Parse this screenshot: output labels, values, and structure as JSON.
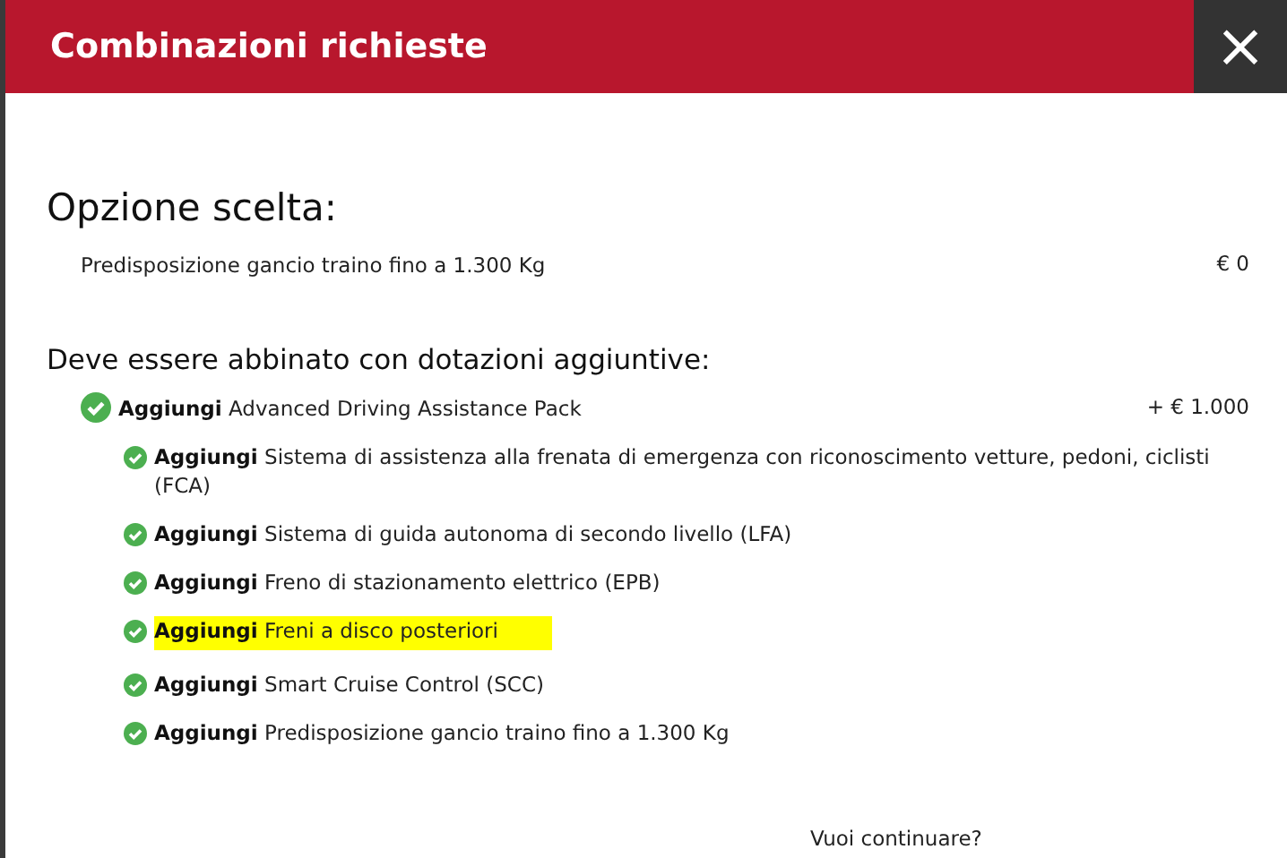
{
  "dialog": {
    "title": "Combinazioni richieste",
    "close_icon": "×"
  },
  "chosen_option": {
    "heading": "Opzione scelta:",
    "name": "Predisposizione gancio traino fino a 1.300 Kg",
    "price": "€ 0"
  },
  "required": {
    "heading": "Deve essere abbinato con dotazioni aggiuntive:",
    "items": [
      {
        "text": "**Aggiungi** Advanced Driving Assistance Pack",
        "price": "+ € 1.000",
        "checked": true,
        "highlighted": false,
        "children": [
          {
            "text": "**Aggiungi** Sistema di assistenza alla frenata di emergenza con riconoscimento vetture, pedoni, ciclisti (FCA)",
            "checked": true,
            "highlighted": false
          },
          {
            "text": "**Aggiungi** Sistema di guida autonoma di secondo livello (LFA)",
            "checked": true,
            "highlighted": false
          },
          {
            "text": "**Aggiungi** Freno di stazionamento elettrico (EPB)",
            "checked": true,
            "highlighted": false
          },
          {
            "text": "**Aggiungi** Freni a disco posteriori",
            "checked": true,
            "highlighted": true
          },
          {
            "text": "**Aggiungi** Smart Cruise Control (SCC)",
            "checked": true,
            "highlighted": false
          },
          {
            "text": "**Aggiungi** Predisposizione gancio traino fino a 1.300 Kg",
            "checked": true,
            "highlighted": false
          }
        ]
      }
    ]
  },
  "question": "Vuoi continuare?"
}
